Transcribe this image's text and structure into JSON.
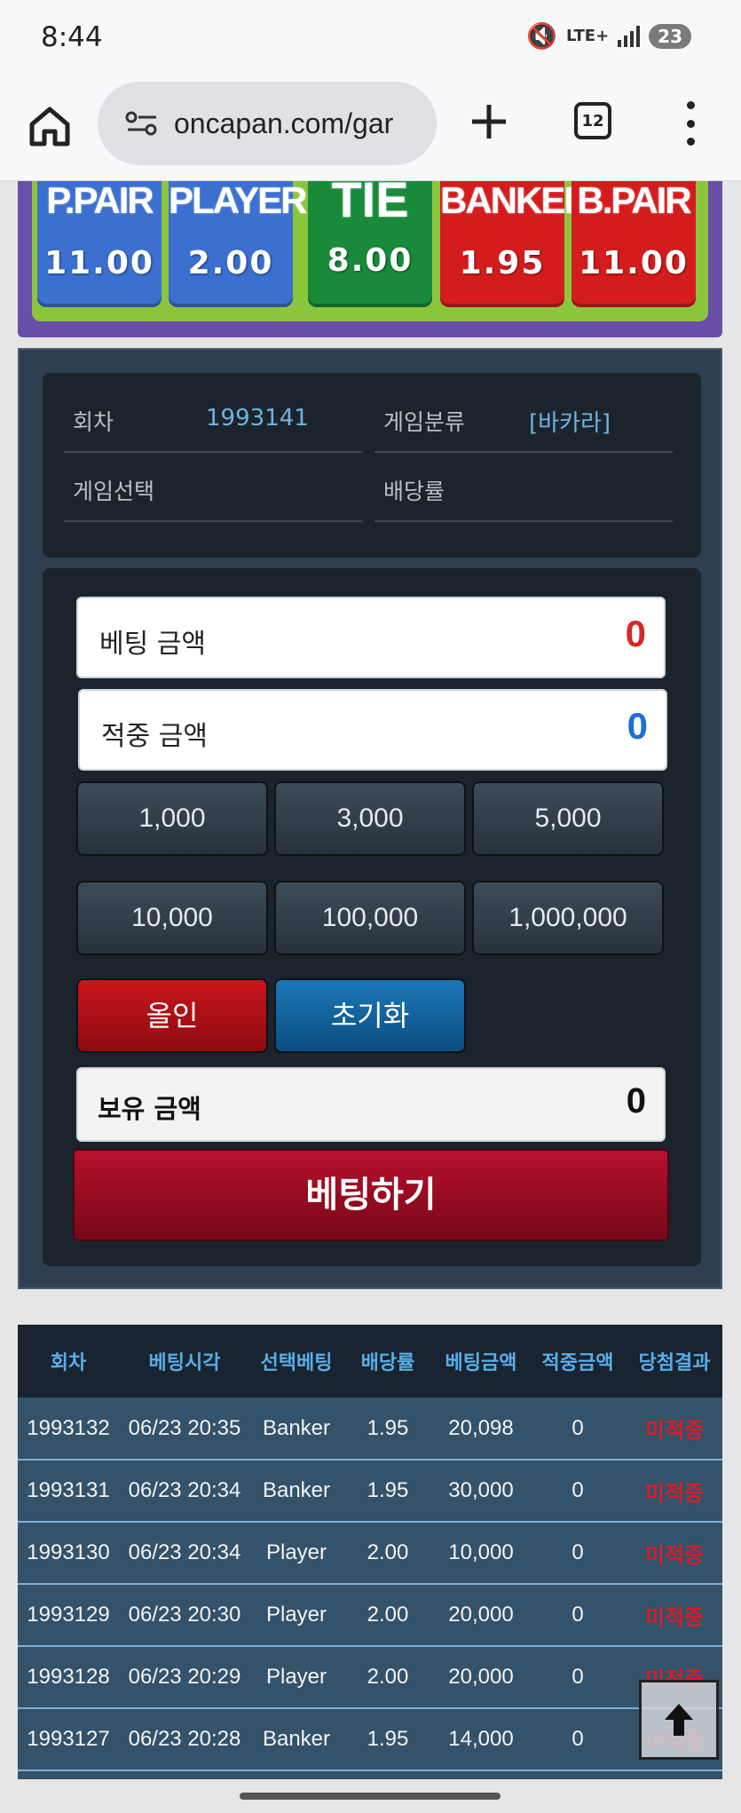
{
  "status_bar": {
    "time": "8:44",
    "network": "LTE+",
    "battery": "23"
  },
  "browser": {
    "url": "oncapan.com/gar",
    "tab_count": "12"
  },
  "odds": [
    {
      "label": "P.PAIR",
      "value": "11.00",
      "color": "#3b6fd0"
    },
    {
      "label": "PLAYER",
      "value": "2.00",
      "color": "#3b6fd0"
    },
    {
      "label": "TIE",
      "value": "8.00",
      "color": "#188a3a"
    },
    {
      "label": "BANKER",
      "value": "1.95",
      "color": "#d41c1c"
    },
    {
      "label": "B.PAIR",
      "value": "11.00",
      "color": "#d41c1c"
    }
  ],
  "info": {
    "round_label": "회차",
    "round_value": "1993141",
    "category_label": "게임분류",
    "category_value": "[바카라]",
    "selection_label": "게임선택",
    "selection_value": "",
    "odds_label": "배당률",
    "odds_value": ""
  },
  "bet": {
    "bet_amount_label": "베팅 금액",
    "bet_amount_value": "0",
    "win_amount_label": "적중 금액",
    "win_amount_value": "0",
    "chips": [
      "1,000",
      "3,000",
      "5,000",
      "10,000",
      "100,000",
      "1,000,000"
    ],
    "allin_label": "올인",
    "reset_label": "초기화",
    "balance_label": "보유 금액",
    "balance_value": "0",
    "submit_label": "베팅하기"
  },
  "history": {
    "headers": [
      "회차",
      "베팅시각",
      "선택베팅",
      "배당률",
      "베팅금액",
      "적중금액",
      "당첨결과"
    ],
    "rows": [
      [
        "1993132",
        "06/23 20:35",
        "Banker",
        "1.95",
        "20,098",
        "0",
        "미적중"
      ],
      [
        "1993131",
        "06/23 20:34",
        "Banker",
        "1.95",
        "30,000",
        "0",
        "미적중"
      ],
      [
        "1993130",
        "06/23 20:34",
        "Player",
        "2.00",
        "10,000",
        "0",
        "미적중"
      ],
      [
        "1993129",
        "06/23 20:30",
        "Player",
        "2.00",
        "20,000",
        "0",
        "미적중"
      ],
      [
        "1993128",
        "06/23 20:29",
        "Player",
        "2.00",
        "20,000",
        "0",
        "미적중"
      ],
      [
        "1993127",
        "06/23 20:28",
        "Banker",
        "1.95",
        "14,000",
        "0",
        "미적중"
      ]
    ]
  },
  "colors": {
    "bet_amount": "#d62828",
    "win_amount": "#1f6fd0",
    "result_lose": "#d2202a"
  }
}
